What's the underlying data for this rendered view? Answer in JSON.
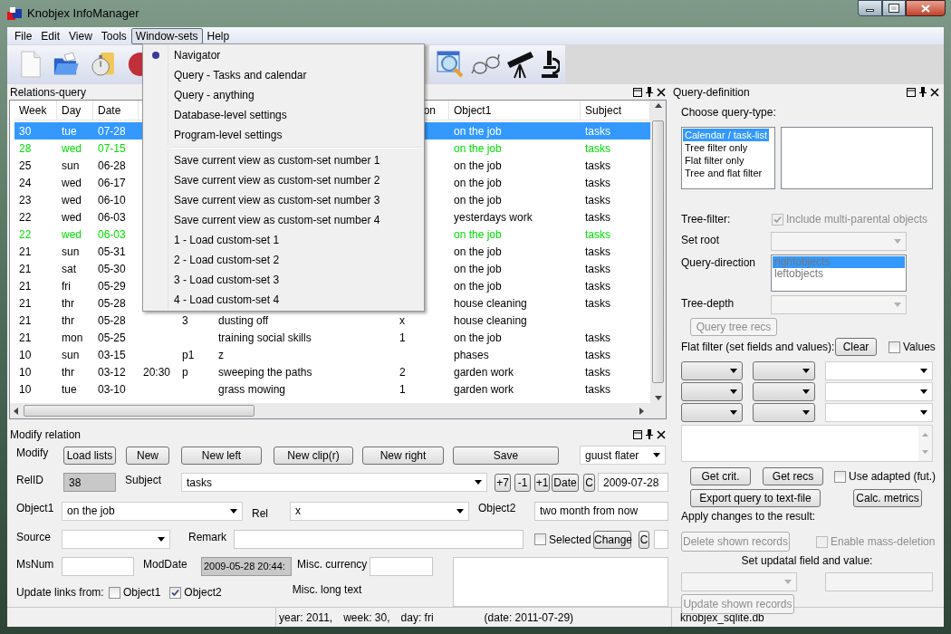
{
  "window": {
    "title": "Knobjex InfoManager"
  },
  "menubar": [
    {
      "label": "File",
      "selected": false
    },
    {
      "label": "Edit",
      "selected": false
    },
    {
      "label": "View",
      "selected": false
    },
    {
      "label": "Tools",
      "selected": false
    },
    {
      "label": "Window-sets",
      "selected": true
    },
    {
      "label": "Help",
      "selected": false
    }
  ],
  "open_menu": {
    "groups": [
      [
        {
          "label": "Navigator",
          "checked": true
        },
        {
          "label": "Query - Tasks and calendar",
          "checked": false
        },
        {
          "label": "Query - anything",
          "checked": false
        },
        {
          "label": "Database-level settings",
          "checked": false
        },
        {
          "label": "Program-level settings",
          "checked": false
        }
      ],
      [
        {
          "label": "Save current view as custom-set number 1",
          "checked": false
        },
        {
          "label": "Save current view as custom-set number 2",
          "checked": false
        },
        {
          "label": "Save current view as custom-set number 3",
          "checked": false
        },
        {
          "label": "Save current view as custom-set number 4",
          "checked": false
        },
        {
          "label": "1 - Load custom-set 1",
          "checked": false
        },
        {
          "label": "2 - Load custom-set 2",
          "checked": false
        },
        {
          "label": "3 - Load custom-set 3",
          "checked": false
        },
        {
          "label": "4 - Load custom-set 4",
          "checked": false
        }
      ]
    ]
  },
  "relations_query": {
    "title": "Relations-query",
    "columns": {
      "week": "Week",
      "day": "Day",
      "date": "Date",
      "column_7": "on",
      "object1": "Object1",
      "subject": "Subject"
    },
    "rows": [
      {
        "week": "30",
        "day": "tue",
        "date": "07-28",
        "object1": "on the job",
        "subject": "tasks",
        "selected": true
      },
      {
        "week": "28",
        "day": "wed",
        "date": "07-15",
        "object1": "on the job",
        "subject": "tasks",
        "color": "#00e000",
        "selected": false
      },
      {
        "week": "25",
        "day": "sun",
        "date": "06-28",
        "object1": "on the job",
        "subject": "tasks",
        "color": "#000000",
        "selected": false
      },
      {
        "week": "24",
        "day": "wed",
        "date": "06-17",
        "object1": "on the job",
        "subject": "tasks",
        "color": "#000000",
        "selected": false
      },
      {
        "week": "23",
        "day": "wed",
        "date": "06-10",
        "object1": "on the job",
        "subject": "tasks",
        "color": "#000000",
        "selected": false
      },
      {
        "week": "22",
        "day": "wed",
        "date": "06-03",
        "object1": "yesterdays work",
        "subject": "tasks",
        "color": "#000000",
        "selected": false
      },
      {
        "week": "22",
        "day": "wed",
        "date": "06-03",
        "object1": "on the job",
        "subject": "tasks",
        "color": "#00e000",
        "selected": false
      },
      {
        "week": "21",
        "day": "sun",
        "date": "05-31",
        "object1": "on the job",
        "subject": "tasks",
        "color": "#000000",
        "selected": false
      },
      {
        "week": "21",
        "day": "sat",
        "date": "05-30",
        "object1": "on the job",
        "subject": "tasks",
        "color": "#000000",
        "selected": false
      },
      {
        "week": "21",
        "day": "fri",
        "date": "05-29",
        "object1": "on the job",
        "subject": "tasks",
        "color": "#000000",
        "selected": false
      },
      {
        "week": "21",
        "day": "thr",
        "date": "05-28",
        "object1": "house cleaning",
        "subject": "tasks",
        "color": "#000000",
        "selected": false
      },
      {
        "week": "21",
        "day": "thr",
        "date": "05-28",
        "column_5": "3",
        "column_6": "dusting off",
        "column_7": "x",
        "object1": "house cleaning",
        "color": "#000000",
        "selected": false
      },
      {
        "week": "21",
        "day": "mon",
        "date": "05-25",
        "column_6": "training social skills",
        "column_7": "1",
        "object1": "on the job",
        "subject": "tasks",
        "color": "#000000",
        "selected": false
      },
      {
        "week": "10",
        "day": "sun",
        "date": "03-15",
        "column_5": "p1",
        "column_6": "z",
        "object1": "phases",
        "subject": "tasks",
        "color": "#000000",
        "selected": false
      },
      {
        "week": "10",
        "day": "thr",
        "date": "03-12",
        "column_4": "20:30",
        "column_5": "p",
        "column_6": "sweeping the paths",
        "column_7": "2",
        "object1": "garden work",
        "subject": "tasks",
        "color": "#000000",
        "selected": false
      },
      {
        "week": "10",
        "day": "tue",
        "date": "03-10",
        "column_6": "grass mowing",
        "column_7": "1",
        "object1": "garden work",
        "subject": "tasks",
        "color": "#000000",
        "selected": false
      }
    ]
  },
  "modify_relation": {
    "title": "Modify relation",
    "modify_label": "Modify",
    "buttons": [
      "Load lists",
      "New",
      "New left",
      "New clip(r)",
      "New right",
      "Save"
    ],
    "user": "guust flater",
    "relid_label": "RelID",
    "relid": "38",
    "subject_label": "Subject",
    "subject": "tasks",
    "date_buttons": [
      "+7",
      "-1",
      "+1",
      "Date",
      "C"
    ],
    "date": "2009-07-28",
    "object1_label": "Object1",
    "object1": "on the job",
    "rel_label": "Rel",
    "rel": "x",
    "object2_label": "Object2",
    "object2": "two month from now",
    "source_label": "Source",
    "remark_label": "Remark",
    "selected_checkbox": {
      "label": "Selected",
      "checked": false
    },
    "change_button": "Change",
    "clear_button": "C",
    "msnum_label": "MsNum",
    "moddate_label": "ModDate",
    "moddate": "2009-05-28 20:44:",
    "currency_label": "Misc. currency",
    "long_text_label": "Misc. long text",
    "update_links_label": "Update links from:",
    "links": [
      {
        "label": "Object1",
        "checked": false
      },
      {
        "label": "Object2",
        "checked": true
      }
    ]
  },
  "query_definition": {
    "title": "Query-definition",
    "choose_label": "Choose query-type:",
    "query_types": [
      {
        "label": "Calendar / task-list",
        "selected": true
      },
      {
        "label": "Tree filter only",
        "selected": false
      },
      {
        "label": "Flat filter only",
        "selected": false
      },
      {
        "label": "Tree and flat filter",
        "selected": false
      }
    ],
    "tree_filter_label": "Tree-filter:",
    "multi_parental": {
      "label": "Include multi-parental objects",
      "checked": true,
      "disabled": true
    },
    "set_root": {
      "label": "Set root",
      "disabled": true
    },
    "query_direction": {
      "label": "Query-direction",
      "disabled": true,
      "options": [
        {
          "label": "rightobjects",
          "selected": true
        },
        {
          "label": "leftobjects",
          "selected": false
        }
      ]
    },
    "tree_depth": {
      "label": "Tree-depth",
      "disabled": true
    },
    "query_tree_button": {
      "label": "Query tree recs",
      "disabled": true
    },
    "flat_filter_label": "Flat filter (set fields and values):",
    "clear_button": "Clear",
    "values_checkbox": {
      "label": "Values",
      "checked": false
    },
    "get_crit_button": "Get crit.",
    "get_recs_button": "Get recs",
    "use_adapted": {
      "label": "Use adapted (fut.)",
      "checked": false
    },
    "export_button": "Export query to text-file",
    "calc_button": "Calc. metrics",
    "apply_label": "Apply changes to the result:",
    "delete_button": {
      "label": "Delete shown records",
      "disabled": true
    },
    "mass_deletion": {
      "label": "Enable mass-deletion",
      "checked": false,
      "disabled": true
    },
    "update_label": "Set updatal field and value:",
    "update_field": {
      "disabled": true
    },
    "update_button": {
      "label": "Update shown records",
      "disabled": true
    }
  },
  "status_bar": {
    "year": "year: 2011,",
    "week": "week: 30,",
    "day": "day: fri",
    "date": "(date: 2011-07-29)",
    "database": "knobjex_sqlite.db"
  }
}
